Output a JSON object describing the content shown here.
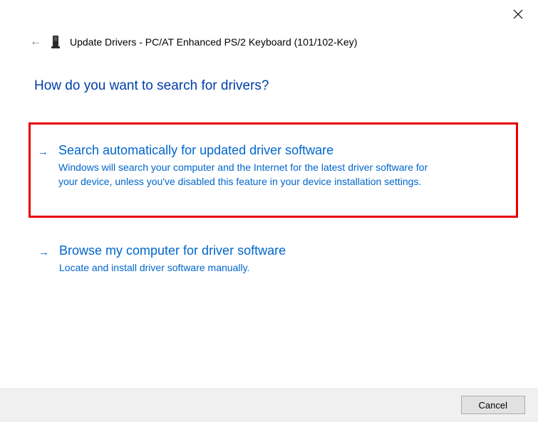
{
  "window": {
    "title": "Update Drivers - PC/AT Enhanced PS/2 Keyboard (101/102-Key)"
  },
  "main": {
    "question": "How do you want to search for drivers?",
    "options": [
      {
        "title": "Search automatically for updated driver software",
        "description": "Windows will search your computer and the Internet for the latest driver software for your device, unless you've disabled this feature in your device installation settings.",
        "highlighted": true
      },
      {
        "title": "Browse my computer for driver software",
        "description": "Locate and install driver software manually.",
        "highlighted": false
      }
    ]
  },
  "footer": {
    "cancel_label": "Cancel"
  }
}
